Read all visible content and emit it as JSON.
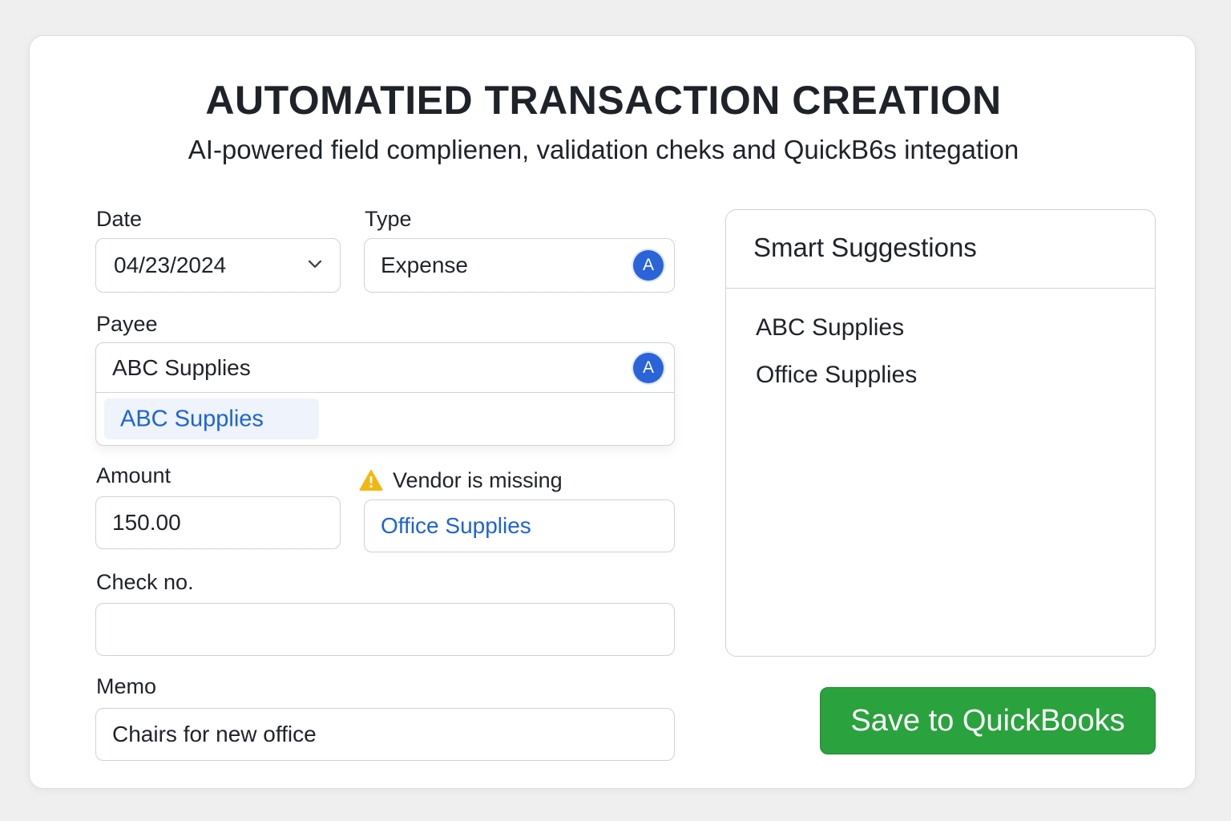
{
  "header": {
    "title": "AUTOMATIED TRANSACTION CREATION",
    "subtitle": "AI-powered field complienen, validation cheks and QuickB6s integation"
  },
  "form": {
    "date": {
      "label": "Date",
      "value": "04/23/2024"
    },
    "type": {
      "label": "Type",
      "value": "Expense",
      "ai_badge": "A"
    },
    "payee": {
      "label": "Payee",
      "value": "ABC Supplies",
      "ai_badge": "A",
      "dropdown_options": [
        "ABC Supplies"
      ]
    },
    "amount": {
      "label": "Amount",
      "value": "150.00"
    },
    "vendor": {
      "warning": "Vendor is missing",
      "value": "Office Supplies"
    },
    "check_no": {
      "label": "Check no.",
      "value": ""
    },
    "memo": {
      "label": "Memo",
      "value": "Chairs for new office"
    }
  },
  "suggestions": {
    "title": "Smart Suggestions",
    "items": [
      "ABC Supplies",
      "Office Supplies"
    ]
  },
  "actions": {
    "save_label": "Save to QuickBooks"
  },
  "colors": {
    "accent_blue": "#1e63d6",
    "badge_blue": "#2b63d9",
    "save_green": "#2aa23e",
    "warning_yellow": "#f5b70f"
  },
  "icons": {
    "ai_badge": "ai-autofill-icon",
    "date_dropdown": "chevron-down-icon",
    "warning": "warning-icon"
  }
}
